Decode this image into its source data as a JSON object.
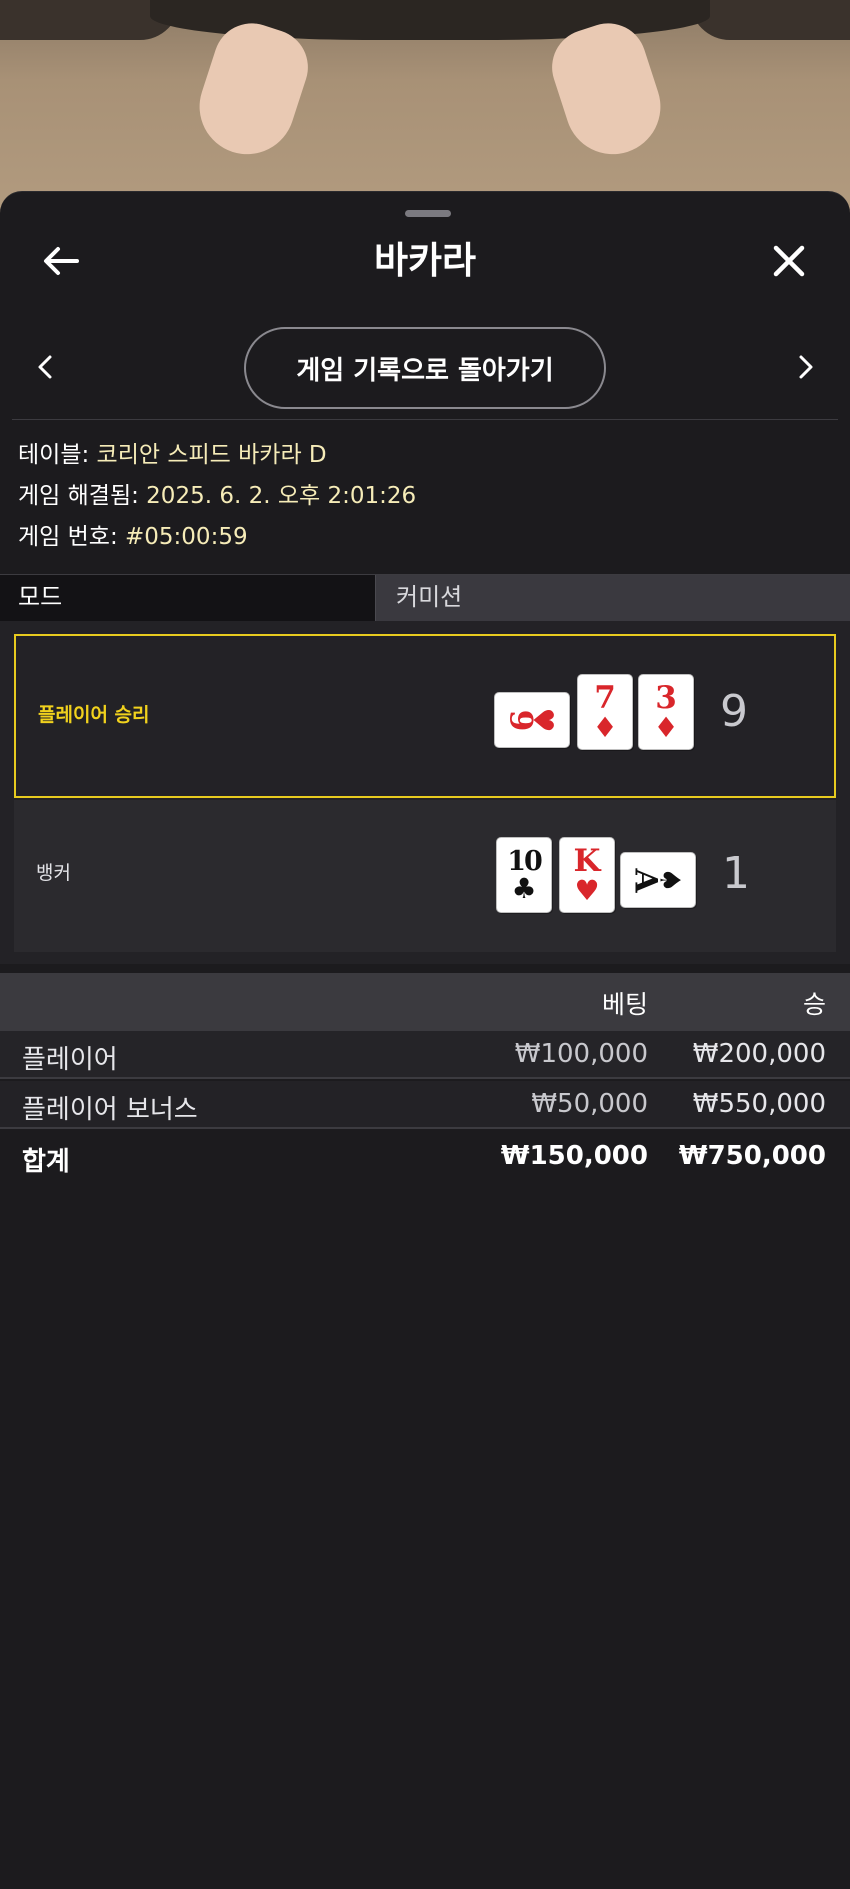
{
  "header": {
    "title": "바카라",
    "back_icon": "arrow-left-icon",
    "close_icon": "close-icon"
  },
  "nav": {
    "back_history_label": "게임 기록으로 돌아가기",
    "prev_icon": "chevron-left-icon",
    "next_icon": "chevron-right-icon"
  },
  "info": {
    "table_label": "테이블: ",
    "table_value": "코리안 스피드 바카라 D",
    "resolved_label": "게임 해결됨: ",
    "resolved_value": "2025. 6. 2. 오후 2:01:26",
    "number_label": "게임 번호: ",
    "number_value": "#05:00:59"
  },
  "tabs": {
    "mode": "모드",
    "commission": "커미션"
  },
  "results": {
    "player": {
      "label": "플레이어 승리",
      "score": "9",
      "cards": [
        {
          "rank": "9",
          "suit": "♥",
          "color": "red",
          "orientation": "horizontal"
        },
        {
          "rank": "7",
          "suit": "♦",
          "color": "red",
          "orientation": "vertical"
        },
        {
          "rank": "3",
          "suit": "♦",
          "color": "red",
          "orientation": "vertical"
        }
      ]
    },
    "banker": {
      "label": "뱅커",
      "score": "1",
      "cards": [
        {
          "rank": "10",
          "suit": "♣",
          "color": "black",
          "orientation": "vertical"
        },
        {
          "rank": "K",
          "suit": "♥",
          "color": "red",
          "orientation": "vertical"
        },
        {
          "rank": "A",
          "suit": "♠",
          "color": "black",
          "orientation": "horizontal"
        }
      ]
    }
  },
  "bets": {
    "headers": {
      "bet": "베팅",
      "win": "승"
    },
    "rows": [
      {
        "name": "플레이어",
        "bet": "₩100,000",
        "win": "₩200,000"
      },
      {
        "name": "플레이어 보너스",
        "bet": "₩50,000",
        "win": "₩550,000"
      },
      {
        "name": "합계",
        "bet": "₩150,000",
        "win": "₩750,000"
      }
    ]
  },
  "colors": {
    "accent_yellow": "#e7cb1f",
    "background": "#1c1b1e",
    "card_red": "#d9262b"
  }
}
